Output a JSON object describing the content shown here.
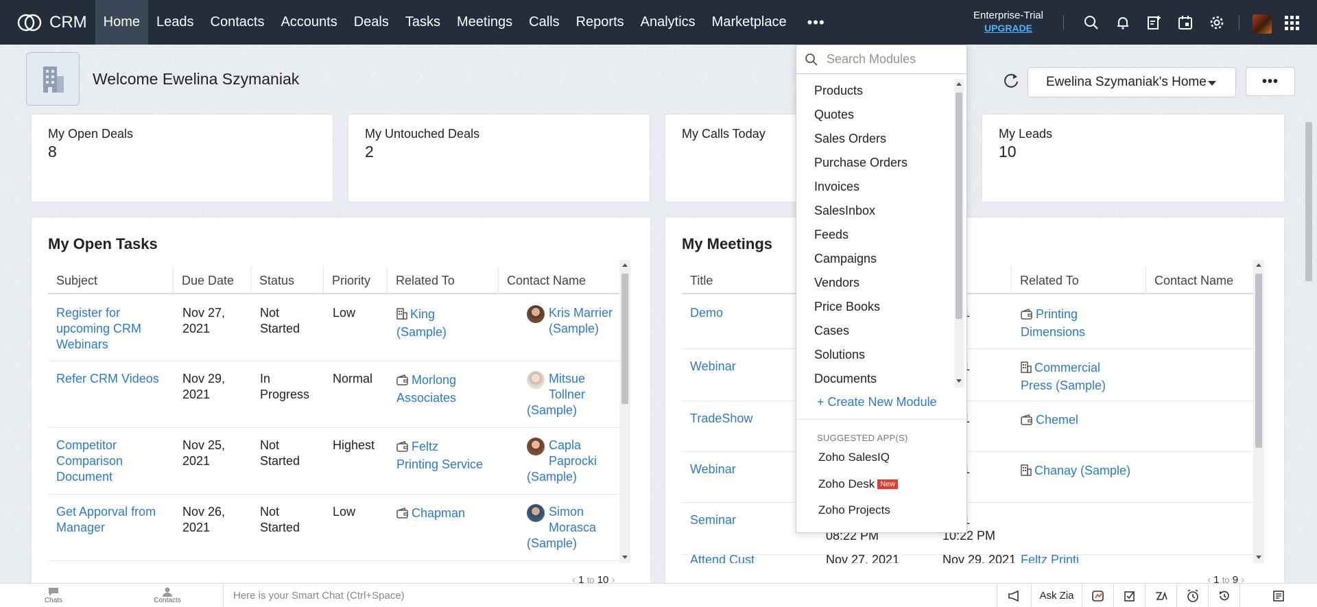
{
  "nav": {
    "brand": "CRM",
    "items": [
      "Home",
      "Leads",
      "Contacts",
      "Accounts",
      "Deals",
      "Tasks",
      "Meetings",
      "Calls",
      "Reports",
      "Analytics",
      "Marketplace"
    ],
    "active": "Home",
    "more_label": "•••",
    "trial_label": "Enterprise-Trial",
    "upgrade_label": "UPGRADE",
    "icons": [
      "search-icon",
      "bell-icon",
      "add-task-icon",
      "calendar-icon",
      "gear-icon",
      "avatar",
      "apps-grid-icon"
    ]
  },
  "welcome": {
    "text": "Welcome Ewelina Szymaniak"
  },
  "home_selector": {
    "label": "Ewelina Szymaniak's Home"
  },
  "more_button": {
    "label": "•••"
  },
  "stats": [
    {
      "label": "My Open Deals",
      "value": "8"
    },
    {
      "label": "My Untouched Deals",
      "value": "2"
    },
    {
      "label": "My Calls Today",
      "value": ""
    },
    {
      "label": "My Leads",
      "value": "10"
    }
  ],
  "tasks": {
    "title": "My Open Tasks",
    "columns": [
      "Subject",
      "Due Date",
      "Status",
      "Priority",
      "Related To",
      "Contact Name"
    ],
    "rows": [
      {
        "subject": [
          "Register for",
          "upcoming CRM",
          "Webinars"
        ],
        "due": [
          "Nov 27,",
          "2021"
        ],
        "status": [
          "Not",
          "Started"
        ],
        "priority": "Low",
        "related": [
          "King",
          "(Sample)"
        ],
        "related_icon": "building-icon",
        "contact": [
          "Kris Marrier",
          "(Sample)"
        ]
      },
      {
        "subject": [
          "Refer CRM Videos"
        ],
        "due": [
          "Nov 29,",
          "2021"
        ],
        "status": [
          "In",
          "Progress"
        ],
        "priority": "Normal",
        "related": [
          "Morlong",
          "Associates"
        ],
        "related_icon": "wallet-icon",
        "contact": [
          "Mitsue",
          "Tollner",
          "(Sample)"
        ]
      },
      {
        "subject": [
          "Competitor",
          "Comparison",
          "Document"
        ],
        "due": [
          "Nov 25,",
          "2021"
        ],
        "status": [
          "Not",
          "Started"
        ],
        "priority": "Highest",
        "related": [
          "Feltz",
          "Printing Service"
        ],
        "related_icon": "wallet-icon",
        "contact": [
          "Capla",
          "Paprocki",
          "(Sample)"
        ]
      },
      {
        "subject": [
          "Get Apporval from",
          "Manager"
        ],
        "due": [
          "Nov 26,",
          "2021"
        ],
        "status": [
          "Not",
          "Started"
        ],
        "priority": "Low",
        "related": [
          "Chapman"
        ],
        "related_icon": "wallet-icon",
        "contact": [
          "Simon",
          "Morasca",
          "(Sample)"
        ]
      }
    ],
    "pager": {
      "from": "1",
      "to_word": "to",
      "to": "10"
    }
  },
  "meetings": {
    "title": "My Meetings",
    "columns": [
      "Title",
      "Related To",
      "Contact Name"
    ],
    "rows": [
      {
        "title": "Demo",
        "to_date": [
          "2021",
          "M"
        ],
        "related": [
          "Printing",
          "Dimensions"
        ],
        "related_icon": "wallet-icon"
      },
      {
        "title": "Webinar",
        "to_date": [
          "2021",
          "M"
        ],
        "related": [
          "Commercial",
          "Press (Sample)"
        ],
        "related_icon": "building-icon"
      },
      {
        "title": "TradeShow",
        "to_date": [
          "2021",
          "AM"
        ],
        "related": [
          "Chemel"
        ],
        "related_icon": "wallet-icon"
      },
      {
        "title": "Webinar",
        "to_date": [
          "2021",
          "AM"
        ],
        "related": [
          "Chanay (Sample)"
        ],
        "related_icon": "building-icon"
      },
      {
        "title": "Seminar",
        "from_date": [
          "08:22 PM"
        ],
        "to_date": [
          "2021",
          "10:22 PM"
        ],
        "related": [],
        "related_icon": ""
      }
    ],
    "partial_row": {
      "title": "Attend Cust",
      "from_date": "Nov 27, 2021",
      "to_date": "Nov 29, 2021",
      "related": "Feltz Printi"
    },
    "pager": {
      "from": "1",
      "to_word": "to",
      "to": "9"
    }
  },
  "module_dropdown": {
    "search_placeholder": "Search Modules",
    "items": [
      "Products",
      "Quotes",
      "Sales Orders",
      "Purchase Orders",
      "Invoices",
      "SalesInbox",
      "Feeds",
      "Campaigns",
      "Vendors",
      "Price Books",
      "Cases",
      "Solutions",
      "Documents"
    ],
    "create_label": "+ Create New Module",
    "suggested_title": "SUGGESTED APP(S)",
    "suggested_apps": [
      "Zoho SalesIQ",
      "Zoho Desk",
      "Zoho Projects"
    ],
    "new_badge": "New"
  },
  "bottombar": {
    "chats_label": "Chats",
    "contacts_label": "Contacts",
    "smartchat_placeholder": "Here is your Smart Chat (Ctrl+Space)",
    "ask_zia": "Ask Zia"
  },
  "colors": {
    "nav_bg": "#232d3b",
    "link": "#2b7ad1",
    "upgrade": "#4fb3ff",
    "new_badge": "#e53b2c"
  }
}
